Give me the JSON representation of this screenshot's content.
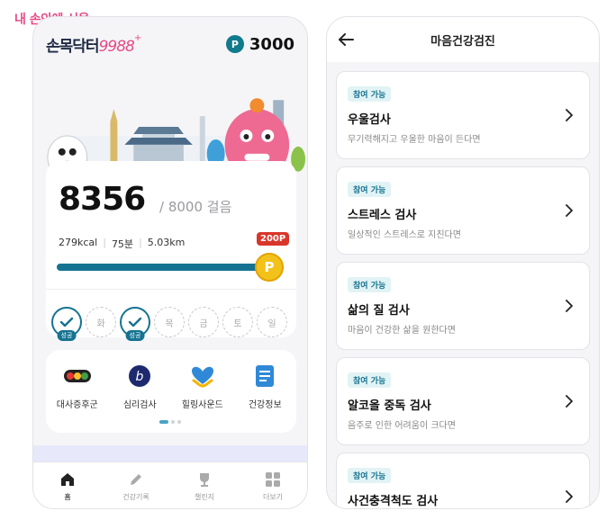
{
  "brand": "내 손안에 서울",
  "left_app": {
    "logo_text": "손목닥터",
    "logo_number": "9988",
    "logo_plus": "+",
    "points_icon": "P",
    "points": "3000",
    "steps": {
      "count": "8356",
      "goal": "/ 8000 걸음",
      "kcal": "279kcal",
      "minutes": "75분",
      "distance": "5.03km",
      "reward_badge": "200P",
      "coin_label": "P",
      "progress_fraction": 1.0
    },
    "week": [
      {
        "label": "",
        "done": true,
        "tag": "성공"
      },
      {
        "label": "화",
        "done": false,
        "tag": ""
      },
      {
        "label": "",
        "done": true,
        "tag": "성공"
      },
      {
        "label": "목",
        "done": false,
        "tag": ""
      },
      {
        "label": "금",
        "done": false,
        "tag": ""
      },
      {
        "label": "토",
        "done": false,
        "tag": ""
      },
      {
        "label": "일",
        "done": false,
        "tag": ""
      }
    ],
    "menu": [
      {
        "label": "대사증후군",
        "icon": "traffic-light-icon"
      },
      {
        "label": "심리검사",
        "icon": "b-circle-icon"
      },
      {
        "label": "힐링사운드",
        "icon": "hands-heart-icon"
      },
      {
        "label": "건강정보",
        "icon": "document-icon"
      }
    ],
    "nav": [
      {
        "label": "홈",
        "icon": "home-icon",
        "active": true
      },
      {
        "label": "건강기록",
        "icon": "pencil-icon",
        "active": false
      },
      {
        "label": "챌린지",
        "icon": "trophy-icon",
        "active": false
      },
      {
        "label": "더보기",
        "icon": "grid-icon",
        "active": false
      }
    ]
  },
  "right_app": {
    "title": "마음건강검진",
    "cards": [
      {
        "tag": "참여 가능",
        "title": "우울검사",
        "desc": "무기력해지고 우울한 마음이 든다면"
      },
      {
        "tag": "참여 가능",
        "title": "스트레스 검사",
        "desc": "일상적인 스트레스로 지친다면"
      },
      {
        "tag": "참여 가능",
        "title": "삶의 질 검사",
        "desc": "마음이 건강한 삶을 원한다면"
      },
      {
        "tag": "참여 가능",
        "title": "알코올 중독 검사",
        "desc": "음주로 인한 어려움이 크다면"
      },
      {
        "tag": "참여 가능",
        "title": "사건충격척도 검사",
        "desc": ""
      }
    ]
  },
  "colors": {
    "accent": "#157391",
    "brand_pink": "#e74a86",
    "reward_red": "#d9362b",
    "coin_gold": "#f3c21a"
  }
}
